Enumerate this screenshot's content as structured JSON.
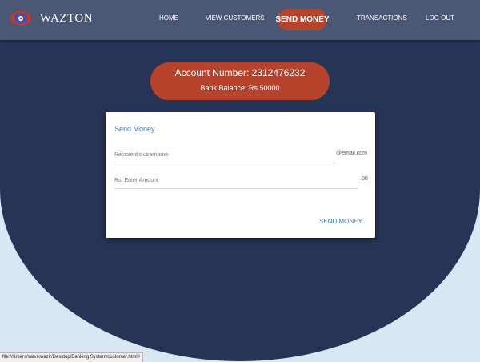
{
  "brand": {
    "name": "WAZTON",
    "logo_icon": "eye-logo-icon"
  },
  "nav": {
    "items": [
      {
        "label": "HOME"
      },
      {
        "label": "VIEW CUSTOMERS"
      },
      {
        "label": "SEND MONEY",
        "active": true
      },
      {
        "label": "TRANSACTIONS"
      },
      {
        "label": "LOG OUT"
      }
    ]
  },
  "account": {
    "number_text": "Account Number: 2312476232",
    "balance_text": "Bank Balance: Rs 50000"
  },
  "form": {
    "title": "Send Money",
    "recipient_placeholder": "Recipient's username",
    "recipient_value": "",
    "recipient_suffix": "@email.com",
    "amount_placeholder": "Rs: Enter Amount",
    "amount_value": "",
    "amount_suffix": ".00",
    "submit_label": "SEND MONEY"
  },
  "status_bar": {
    "url": "file:///Users/satvikwazir/Desktop/Banking System/customer.html#"
  },
  "colors": {
    "navbar": "#4a5775",
    "hero": "#263455",
    "accent": "#b8432c",
    "link": "#3a7bbf",
    "page_bg": "#d7e7f3"
  }
}
